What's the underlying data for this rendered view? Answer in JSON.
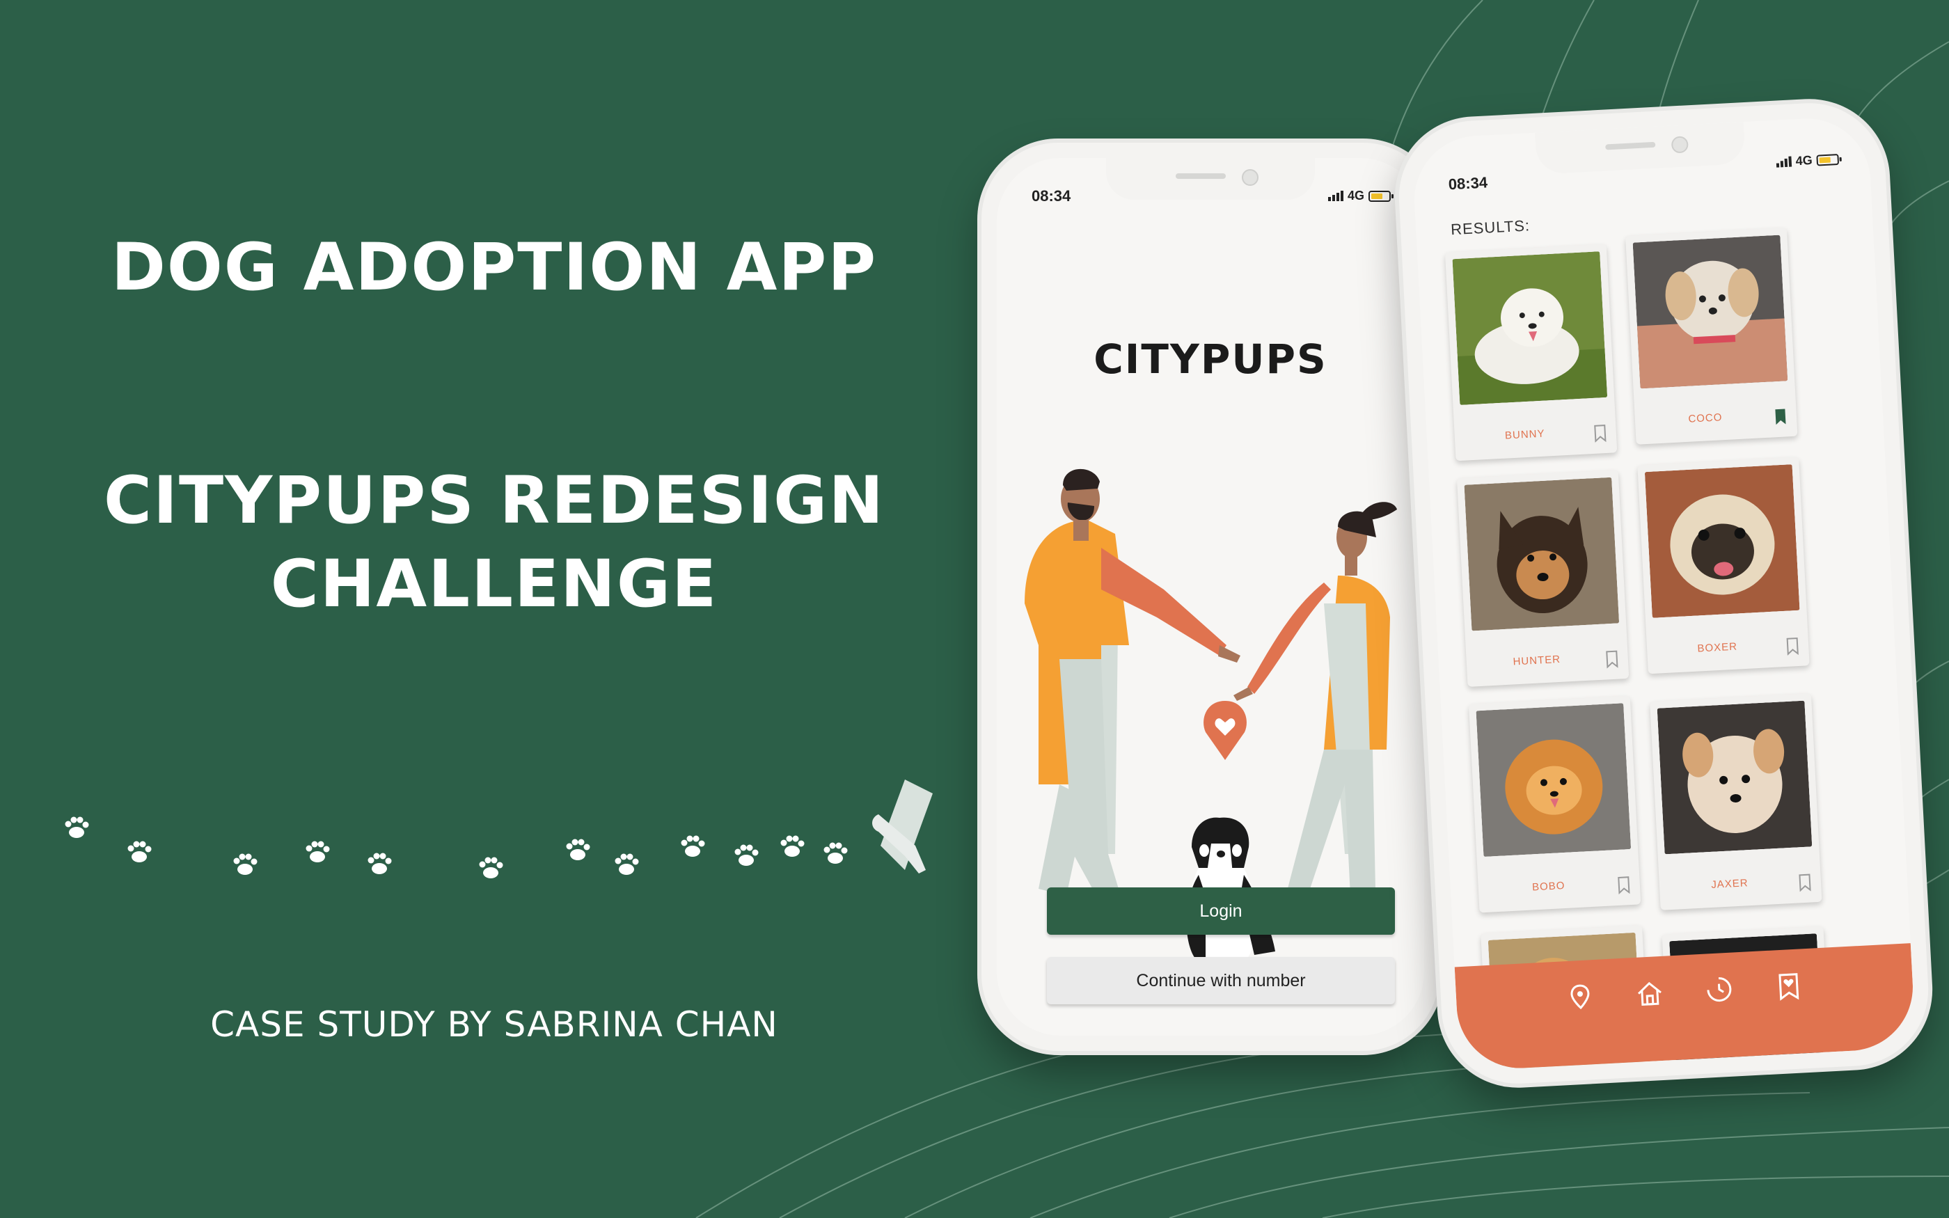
{
  "hero": {
    "title": "DOG ADOPTION APP",
    "subtitle_line1": "CITYPUPS REDESIGN",
    "subtitle_line2": "CHALLENGE",
    "byline": "CASE STUDY BY SABRINA CHAN"
  },
  "colors": {
    "background": "#2c5f48",
    "primary": "#2e6046",
    "accent": "#e0734f",
    "orange": "#f5a033"
  },
  "phone1": {
    "time": "08:34",
    "network": "4G",
    "brand": "CITYPUPS",
    "login_label": "Login",
    "number_label": "Continue with number"
  },
  "phone2": {
    "time": "08:34",
    "network": "4G",
    "results_label": "RESULTS:",
    "dogs": [
      {
        "name": "BUNNY",
        "saved": false
      },
      {
        "name": "COCO",
        "saved": true
      },
      {
        "name": "HUNTER",
        "saved": false
      },
      {
        "name": "BOXER",
        "saved": false
      },
      {
        "name": "BOBO",
        "saved": false
      },
      {
        "name": "JAXER",
        "saved": false
      }
    ],
    "tabs": [
      "location-icon",
      "home-icon",
      "history-icon",
      "saved-icon"
    ]
  }
}
